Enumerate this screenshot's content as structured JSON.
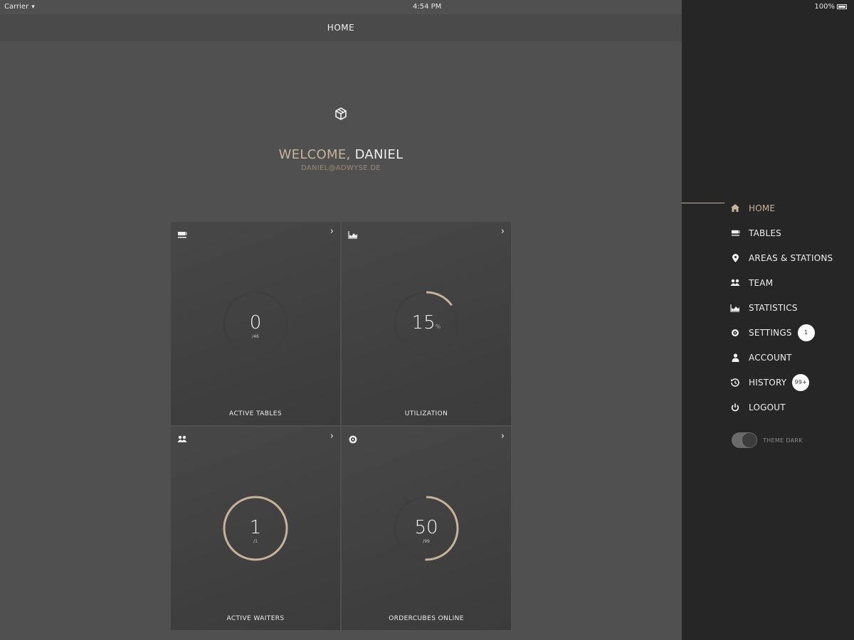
{
  "status_bar": {
    "carrier": "Carrier",
    "time": "4:54 PM",
    "battery": "100%"
  },
  "nav": {
    "title": "HOME"
  },
  "welcome": {
    "greeting": "WELCOME,",
    "name": "DANIEL",
    "email": "DANIEL@ADWYSE.DE"
  },
  "colors": {
    "accent": "#c9b29a",
    "sidebar_bg": "#262626",
    "main_bg": "#505050"
  },
  "cards": [
    {
      "icon": "table-icon",
      "value": "0",
      "suffix": "",
      "unit": "/46",
      "label": "ACTIVE TABLES",
      "progress": 0
    },
    {
      "icon": "chart-icon",
      "value": "15",
      "suffix": "%",
      "unit": "",
      "label": "UTILIZATION",
      "progress": 0.15
    },
    {
      "icon": "team-icon",
      "value": "1",
      "suffix": "",
      "unit": "/1",
      "label": "ACTIVE WAITERS",
      "progress": 1.0
    },
    {
      "icon": "cube-icon",
      "value": "50",
      "suffix": "",
      "unit": "/99",
      "label": "ORDERCUBES ONLINE",
      "progress": 0.505
    }
  ],
  "sidebar": {
    "items": [
      {
        "label": "HOME",
        "icon": "home-icon",
        "active": true
      },
      {
        "label": "TABLES",
        "icon": "table-icon"
      },
      {
        "label": "AREAS & STATIONS",
        "icon": "pin-icon"
      },
      {
        "label": "TEAM",
        "icon": "team-icon"
      },
      {
        "label": "STATISTICS",
        "icon": "chart-icon"
      },
      {
        "label": "SETTINGS",
        "icon": "gear-icon",
        "badge": "1"
      },
      {
        "label": "ACCOUNT",
        "icon": "user-icon"
      },
      {
        "label": "HISTORY",
        "icon": "history-icon",
        "badge": "99+"
      },
      {
        "label": "LOGOUT",
        "icon": "power-icon"
      }
    ],
    "theme_toggle_label": "THEME DARK"
  }
}
